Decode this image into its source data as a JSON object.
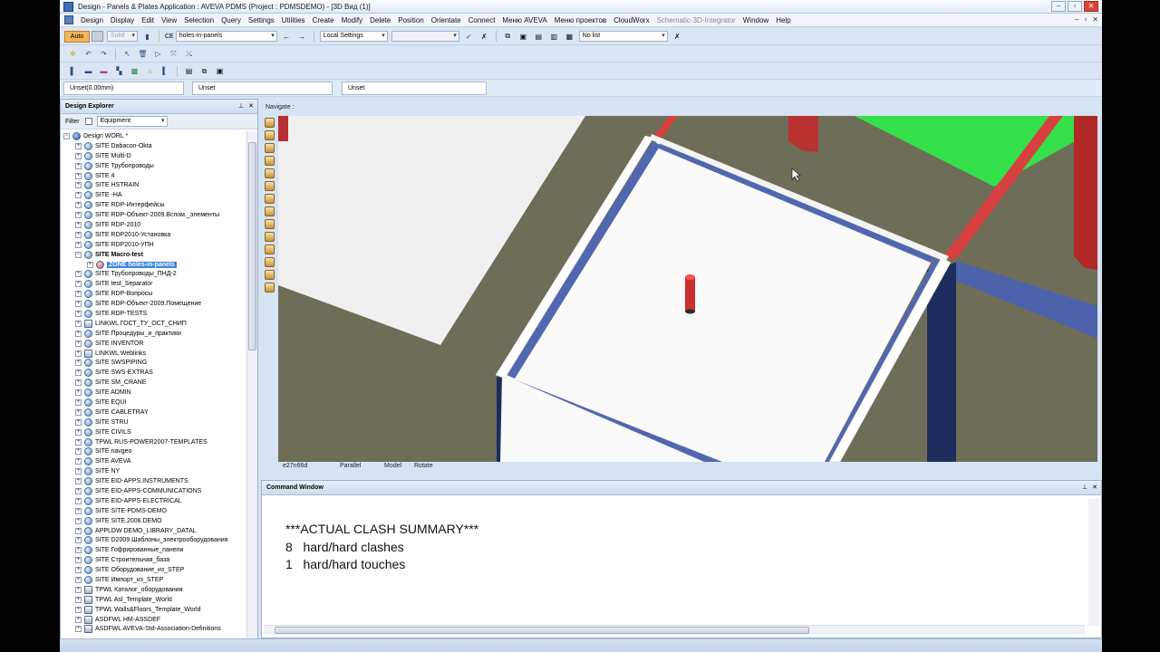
{
  "window": {
    "title": "Design - Panels & Plates Application : AVEVA PDMS (Project : PDMSDEMO) - [3D Вид (1)]",
    "minimize": "–",
    "restore": "▫",
    "close": "✕"
  },
  "menu": {
    "items": [
      "Design",
      "Display",
      "Edit",
      "View",
      "Selection",
      "Query",
      "Settings",
      "Utilities",
      "Create",
      "Modify",
      "Delete",
      "Position",
      "Orientate",
      "Connect",
      "Меню AVEVA",
      "Меню проектов",
      "CloudWorx",
      "Schematic-3D-Integrator",
      "Window",
      "Help"
    ],
    "disabled_index": 17
  },
  "toolbar1": {
    "auto_label": "Auto",
    "solid_label": "Solid",
    "ce_label": "CE",
    "ce_value": "holes-in-panels",
    "local_settings": "Local Settings",
    "no_list": "No list"
  },
  "units": {
    "field1": "Unset(0.00mm)",
    "field2": "Unset",
    "field3": "Unset"
  },
  "explorer": {
    "title": "Design Explorer",
    "filter_label": "Filter",
    "filter_value": "Equipment",
    "root": "Design WORL *",
    "items": [
      {
        "label": "SITE Dabacon-Okta",
        "icon": "site"
      },
      {
        "label": "SITE Multi-D",
        "icon": "site"
      },
      {
        "label": "SITE Трубопроводы",
        "icon": "site"
      },
      {
        "label": "SITE 4",
        "icon": "site"
      },
      {
        "label": "SITE HSTRAIN",
        "icon": "site"
      },
      {
        "label": "SITE -HA",
        "icon": "site"
      },
      {
        "label": "SITE RDP-Интерфейсы",
        "icon": "site"
      },
      {
        "label": "SITE RDP-Объект-2009.Вспом._элементы",
        "icon": "site"
      },
      {
        "label": "SITE RDP-2010",
        "icon": "site"
      },
      {
        "label": "SITE RDP2010-Установка",
        "icon": "site"
      },
      {
        "label": "SITE RDP2010-УПН",
        "icon": "site"
      },
      {
        "label": "SITE Macro-test",
        "icon": "site",
        "bold": true,
        "expanded": true
      },
      {
        "label": "ZONE holes-in-panels",
        "icon": "zone",
        "selected": true,
        "indent": 2
      },
      {
        "label": "SITE Трубопроводы_ПНД-2",
        "icon": "site"
      },
      {
        "label": "SITE test_Separator",
        "icon": "site"
      },
      {
        "label": "SITE RDP-Вопросы",
        "icon": "site"
      },
      {
        "label": "SITE RDP-Объект-2009.Помещение",
        "icon": "site"
      },
      {
        "label": "SITE RDP-TESTS",
        "icon": "site"
      },
      {
        "label": "LINKWL ГОСТ_ТУ_ОСТ_СНИП",
        "icon": "lib"
      },
      {
        "label": "SITE Процедуры_и_практики",
        "icon": "site"
      },
      {
        "label": "SITE INVENTOR",
        "icon": "site"
      },
      {
        "label": "LINKWL Weblinks",
        "icon": "lib"
      },
      {
        "label": "SITE SWSPIPING",
        "icon": "site"
      },
      {
        "label": "SITE SWS-EXTRAS",
        "icon": "site"
      },
      {
        "label": "SITE SM_CRANE",
        "icon": "site"
      },
      {
        "label": "SITE ADMIN",
        "icon": "site"
      },
      {
        "label": "SITE EQUI",
        "icon": "site"
      },
      {
        "label": "SITE CABLETRAY",
        "icon": "site"
      },
      {
        "label": "SITE STRU",
        "icon": "site"
      },
      {
        "label": "SITE CIVILS",
        "icon": "site"
      },
      {
        "label": "TPWL RUS-POWER2007-TEMPLATES",
        "icon": "site"
      },
      {
        "label": "SITE navgeo",
        "icon": "site"
      },
      {
        "label": "SITE AVEVA",
        "icon": "site"
      },
      {
        "label": "SITE NY",
        "icon": "site"
      },
      {
        "label": "SITE EID-APPS.INSTRUMENTS",
        "icon": "site"
      },
      {
        "label": "SITE EID-APPS-COMMUNICATIONS",
        "icon": "site"
      },
      {
        "label": "SITE EID-APPS-ELECTRICAL",
        "icon": "site"
      },
      {
        "label": "SITE SITE-PDMS-DEMO",
        "icon": "site"
      },
      {
        "label": "SITE SITE.2008.DEMO",
        "icon": "site"
      },
      {
        "label": "APPLDW DEMO_LIBRARY_DATAL",
        "icon": "site"
      },
      {
        "label": "SITE D2009.Шаблоны_электрооборудования",
        "icon": "site"
      },
      {
        "label": "SITE Гофрированные_панели",
        "icon": "site"
      },
      {
        "label": "SITE Строительная_база",
        "icon": "site"
      },
      {
        "label": "SITE Оборудование_из_STEP",
        "icon": "site"
      },
      {
        "label": "SITE Импорт_из_STEP",
        "icon": "site"
      },
      {
        "label": "TPWL Каталог_оборудования",
        "icon": "lib"
      },
      {
        "label": "TPWL Asl_Template_World",
        "icon": "lib"
      },
      {
        "label": "TPWL Walls&Floors_Template_World",
        "icon": "lib"
      },
      {
        "label": "ASDFWL HM-ASSDEF",
        "icon": "lib"
      },
      {
        "label": "ASDFWL AVEVA-Std-Association-Definitions",
        "icon": "lib"
      }
    ]
  },
  "navigate": {
    "label": "Navigate :",
    "status": {
      "coords": "e27n66d",
      "projection": "Parallel",
      "mode": "Model",
      "action": "Rotate"
    }
  },
  "command": {
    "title": "Command Window",
    "lines": [
      "***ACTUAL CLASH SUMMARY***",
      "8   hard/hard clashes",
      "1   hard/hard touches"
    ]
  },
  "colors": {
    "floor": "#6e6d58",
    "panel": "#f5f5f5",
    "edge_blue": "#5168b0",
    "column": "#1c2d5e",
    "red": "#d84040",
    "green": "#35e04a",
    "selection": "#3b86e0"
  }
}
